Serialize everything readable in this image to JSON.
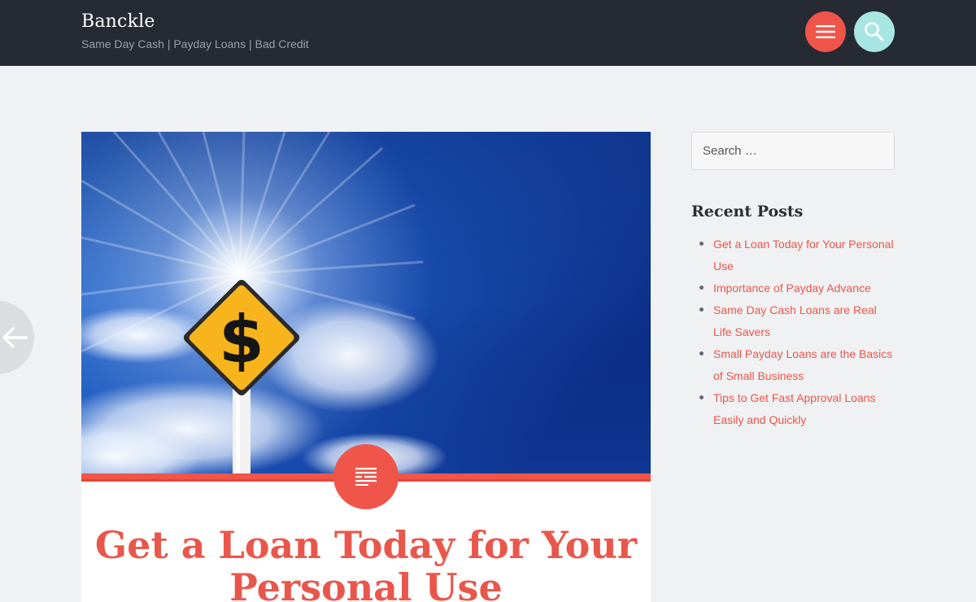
{
  "header": {
    "site_title": "Banckle",
    "tagline": "Same Day Cash | Payday Loans | Bad Credit"
  },
  "sidebar": {
    "search_placeholder": "Search …",
    "recent_posts_title": "Recent Posts",
    "recent_posts": [
      "Get a Loan Today for Your Personal Use",
      "Importance of Payday Advance",
      "Same Day Cash Loans are Real Life Savers",
      "Small Payday Loans are the Basics of Small Business",
      "Tips to Get Fast Approval Loans Easily and Quickly"
    ]
  },
  "article": {
    "title": "Get a Loan Today for Your Personal Use",
    "featured_image": "dollar-sign-road-sign-against-blue-sky",
    "sign_symbol": "$"
  },
  "icons": {
    "menu": "hamburger-menu-icon",
    "search": "magnifier-icon",
    "prev": "arrow-left-icon",
    "format": "text-format-icon"
  },
  "colors": {
    "accent": "#f0554a",
    "header_bg": "#262a32",
    "search_button": "#a8e6e3",
    "link": "#e9574c",
    "page_bg": "#f0f1f3"
  }
}
